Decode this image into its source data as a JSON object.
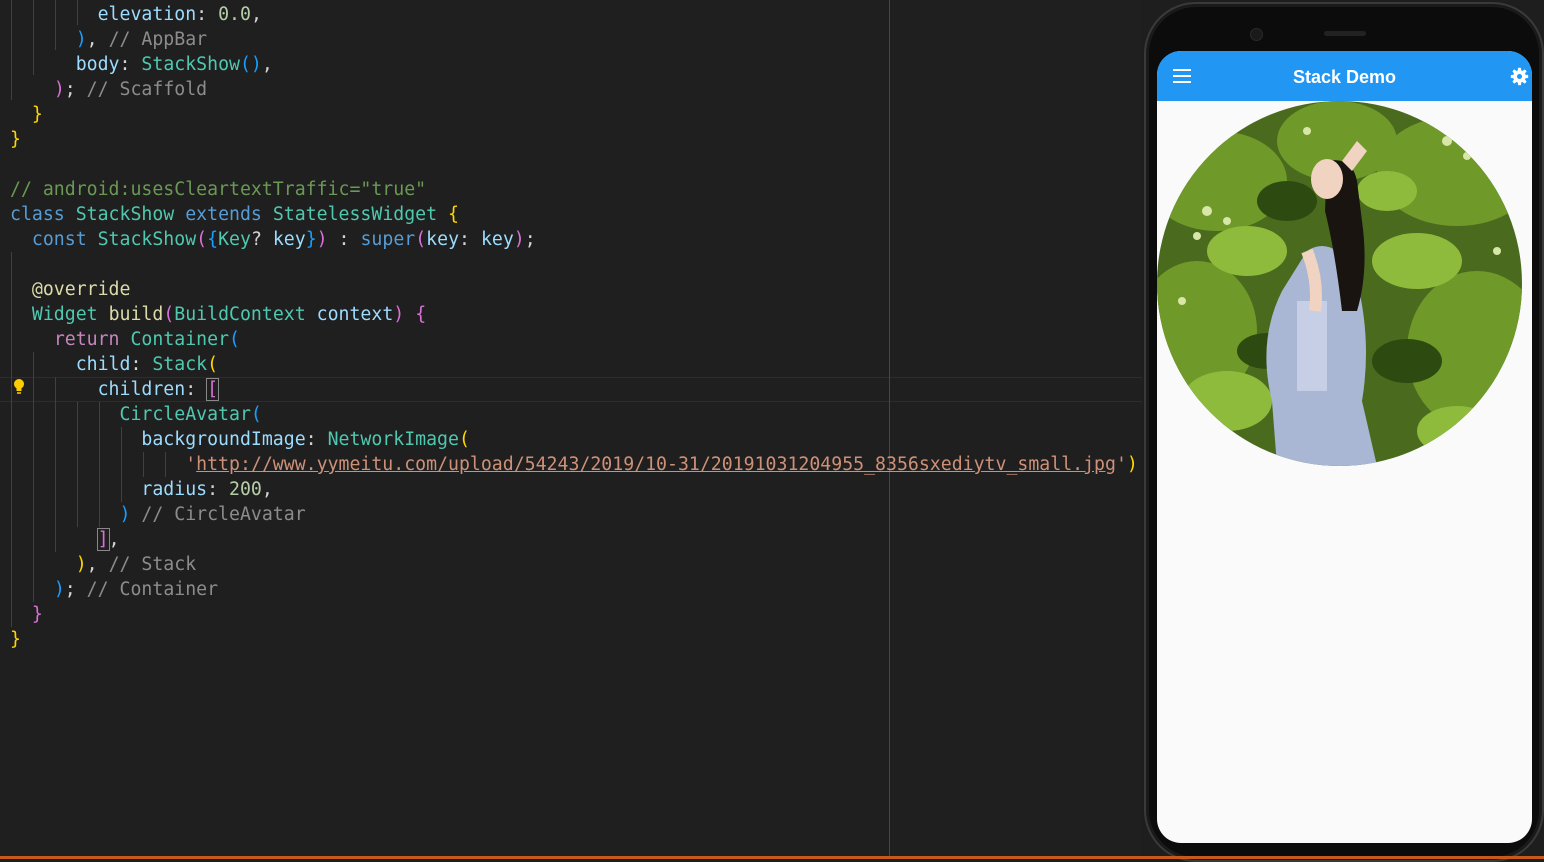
{
  "editor": {
    "comments": {
      "appbar": "// AppBar",
      "scaffold": "// Scaffold",
      "android": "// android:usesCleartextTraffic=\"true\"",
      "circleavatar": "// CircleAvatar",
      "stack": "// Stack",
      "container": "// Container"
    },
    "code": {
      "elevation_key": "elevation",
      "elevation_val": "0.0",
      "body_key": "body",
      "body_val": "StackShow",
      "class_kw": "class",
      "class_name": "StackShow",
      "extends_kw": "extends",
      "base_class": "StatelessWidget",
      "const_kw": "const",
      "ctor_name": "StackShow",
      "key_type": "Key",
      "key_param": "key",
      "super_kw": "super",
      "super_key": "key",
      "super_val": "key",
      "override": "@override",
      "widget_type": "Widget",
      "build_fn": "build",
      "ctx_type": "BuildContext",
      "ctx_var": "context",
      "return_kw": "return",
      "container": "Container",
      "child_key": "child",
      "stack": "Stack",
      "children_key": "children",
      "circle_avatar": "CircleAvatar",
      "bg_key": "backgroundImage",
      "network_image": "NetworkImage",
      "image_url": "http://www.yymeitu.com/upload/54243/2019/10-31/20191031204955_8356sxediytv_small.jpg",
      "radius_key": "radius",
      "radius_val": "200"
    }
  },
  "app": {
    "title": "Stack Demo",
    "icons": [
      "menu-icon",
      "settings-icon"
    ],
    "avatar_radius": 200
  },
  "colors": {
    "appbar": "#2196f3",
    "editor_bg": "#1f1f1f"
  }
}
